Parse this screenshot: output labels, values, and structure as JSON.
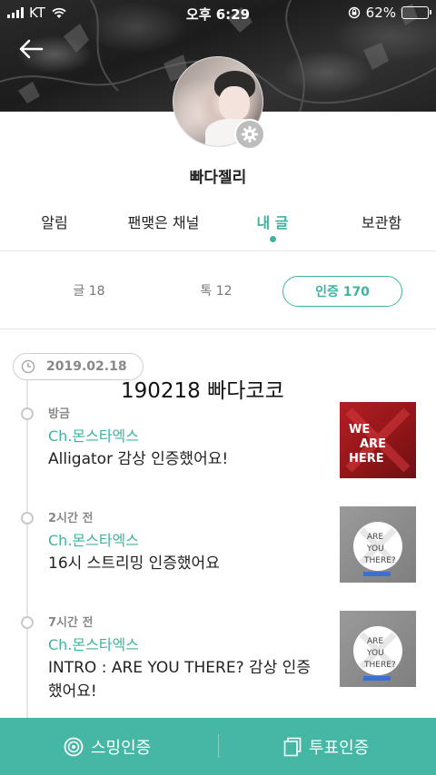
{
  "status_bar": {
    "carrier": "KT",
    "time": "오후 6:29",
    "battery_percent": "62%",
    "battery_level": 0.62
  },
  "profile": {
    "username": "빠다젤리"
  },
  "tabs": [
    {
      "label": "알림"
    },
    {
      "label": "팬맺은 채널"
    },
    {
      "label": "내 글",
      "active": true
    },
    {
      "label": "보관함"
    }
  ],
  "sub_tabs": [
    {
      "label": "글 18"
    },
    {
      "label": "톡 12"
    },
    {
      "label": "인증 170",
      "active": true
    }
  ],
  "timeline": {
    "date": "2019.02.18",
    "overlay_title": "190218 빠다코코",
    "posts": [
      {
        "time": "방금",
        "channel": "Ch.몬스타엑스",
        "text": "Alligator 감상 인증했어요!",
        "thumb_lines": [
          "WE",
          "ARE",
          "HERE"
        ]
      },
      {
        "time": "2시간 전",
        "channel": "Ch.몬스타엑스",
        "text": "16시 스트리밍 인증했어요",
        "thumb_lines": [
          "ARE",
          "YOU",
          "THERE?"
        ]
      },
      {
        "time": "7시간 전",
        "channel": "Ch.몬스타엑스",
        "text": "INTRO : ARE YOU THERE? 감상 인증했어요!",
        "thumb_lines": [
          "ARE",
          "YOU",
          "THERE?"
        ]
      }
    ]
  },
  "bottom_bar": {
    "left_label": "스밍인증",
    "right_label": "투표인증"
  },
  "colors": {
    "accent": "#3fb39f",
    "bottom_bar": "#46b7a4"
  },
  "icons": {
    "back": "arrow-left-icon",
    "settings": "gear-icon",
    "date": "clock-icon",
    "streaming": "disc-icon",
    "vote": "document-icon"
  }
}
